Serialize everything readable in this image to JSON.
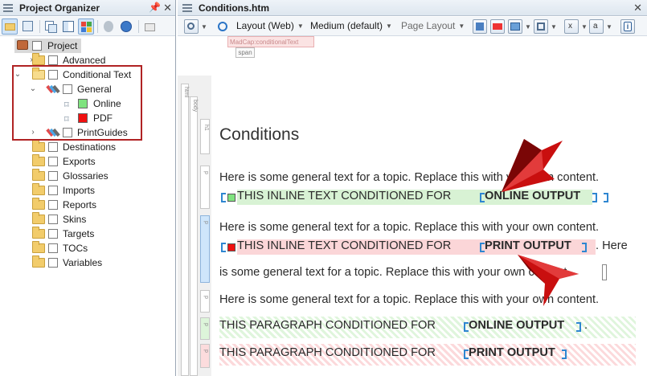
{
  "left_pane": {
    "title": "Project Organizer",
    "pin": "📌",
    "close": "✕"
  },
  "tree": {
    "project": "Project",
    "advanced": "Advanced",
    "conditional_text": "Conditional Text",
    "general": "General",
    "online": "Online",
    "pdf": "PDF",
    "printguides": "PrintGuides",
    "destinations": "Destinations",
    "exports": "Exports",
    "glossaries": "Glossaries",
    "imports": "Imports",
    "reports": "Reports",
    "skins": "Skins",
    "targets": "Targets",
    "tocs": "TOCs",
    "variables": "Variables"
  },
  "colors": {
    "online": "#7fe37f",
    "pdf": "#f01010",
    "highlight_box": "#b02324"
  },
  "doc": {
    "title": "Conditions.htm",
    "close": "✕",
    "layout": "Layout (Web)",
    "medium": "Medium (default)",
    "page_layout": "Page Layout",
    "madcap_tag": "MadCap:conditionalText",
    "span_tag": "span",
    "struct_html": "html",
    "struct_body": "body",
    "struct_h1": "h1",
    "struct_p": "p",
    "heading": "Conditions"
  },
  "content": {
    "p1_text": "Here is some general text for a topic. Replace this with your own content.",
    "p1_cond": "THIS INLINE TEXT CONDITIONED FOR ",
    "p1_bold": "ONLINE OUTPUT",
    "p2_text": "Here is some general text for a topic. Replace this with your own content.",
    "p2_cond": "THIS INLINE TEXT CONDITIONED FOR ",
    "p2_bold": "PRINT OUTPUT",
    "p2_tail": ". Here",
    "p2_line3": "is some general text for a topic. Replace this with your own content.",
    "p3_text": "Here is some general text for a topic. Replace this with your own content.",
    "p4_cond": "THIS PARAGRAPH CONDITIONED FOR ",
    "p4_bold": "ONLINE OUTPUT",
    "p4_tail": ".",
    "p5_cond": "THIS PARAGRAPH CONDITIONED FOR ",
    "p5_bold": "PRINT OUTPUT"
  }
}
